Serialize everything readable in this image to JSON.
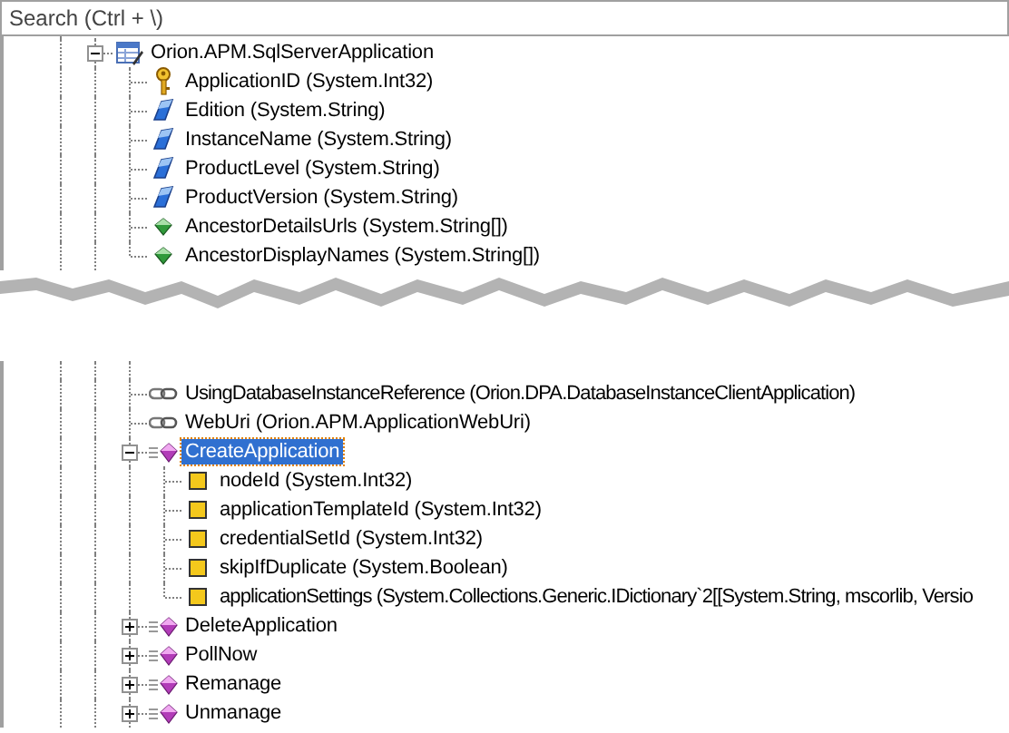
{
  "search": {
    "placeholder": "Search (Ctrl + \\)"
  },
  "tree_top": {
    "label": "Orion.APM.SqlServerApplication",
    "kind": "entity",
    "expanded": true,
    "selected": false,
    "children": [
      {
        "label": "ApplicationID (System.Int32)",
        "kind": "key",
        "selected": false
      },
      {
        "label": "Edition (System.String)",
        "kind": "property",
        "selected": false
      },
      {
        "label": "InstanceName (System.String)",
        "kind": "property",
        "selected": false
      },
      {
        "label": "ProductLevel (System.String)",
        "kind": "property",
        "selected": false
      },
      {
        "label": "ProductVersion (System.String)",
        "kind": "property",
        "selected": false
      },
      {
        "label": "AncestorDetailsUrls (System.String[])",
        "kind": "derived",
        "selected": false
      },
      {
        "label": "AncestorDisplayNames (System.String[])",
        "kind": "derived",
        "selected": false
      }
    ]
  },
  "tree_bottom": [
    {
      "label": "UsingDatabaseInstanceReference (Orion.DPA.DatabaseInstanceClientApplication)",
      "kind": "link",
      "selected": false
    },
    {
      "label": "WebUri (Orion.APM.ApplicationWebUri)",
      "kind": "link",
      "selected": false
    },
    {
      "label": "CreateApplication",
      "kind": "method",
      "expanded": true,
      "selected": true,
      "children": [
        {
          "label": "nodeId (System.Int32)",
          "kind": "param",
          "selected": false
        },
        {
          "label": "applicationTemplateId (System.Int32)",
          "kind": "param",
          "selected": false
        },
        {
          "label": "credentialSetId (System.Int32)",
          "kind": "param",
          "selected": false
        },
        {
          "label": "skipIfDuplicate (System.Boolean)",
          "kind": "param",
          "selected": false
        },
        {
          "label": "applicationSettings (System.Collections.Generic.IDictionary`2[[System.String, mscorlib, Versio",
          "kind": "param",
          "selected": false
        }
      ]
    },
    {
      "label": "DeleteApplication",
      "kind": "method",
      "expanded": false,
      "selected": false
    },
    {
      "label": "PollNow",
      "kind": "method",
      "expanded": false,
      "selected": false
    },
    {
      "label": "Remanage",
      "kind": "method",
      "expanded": false,
      "selected": false
    },
    {
      "label": "Unmanage",
      "kind": "method",
      "expanded": false,
      "selected": false
    }
  ]
}
